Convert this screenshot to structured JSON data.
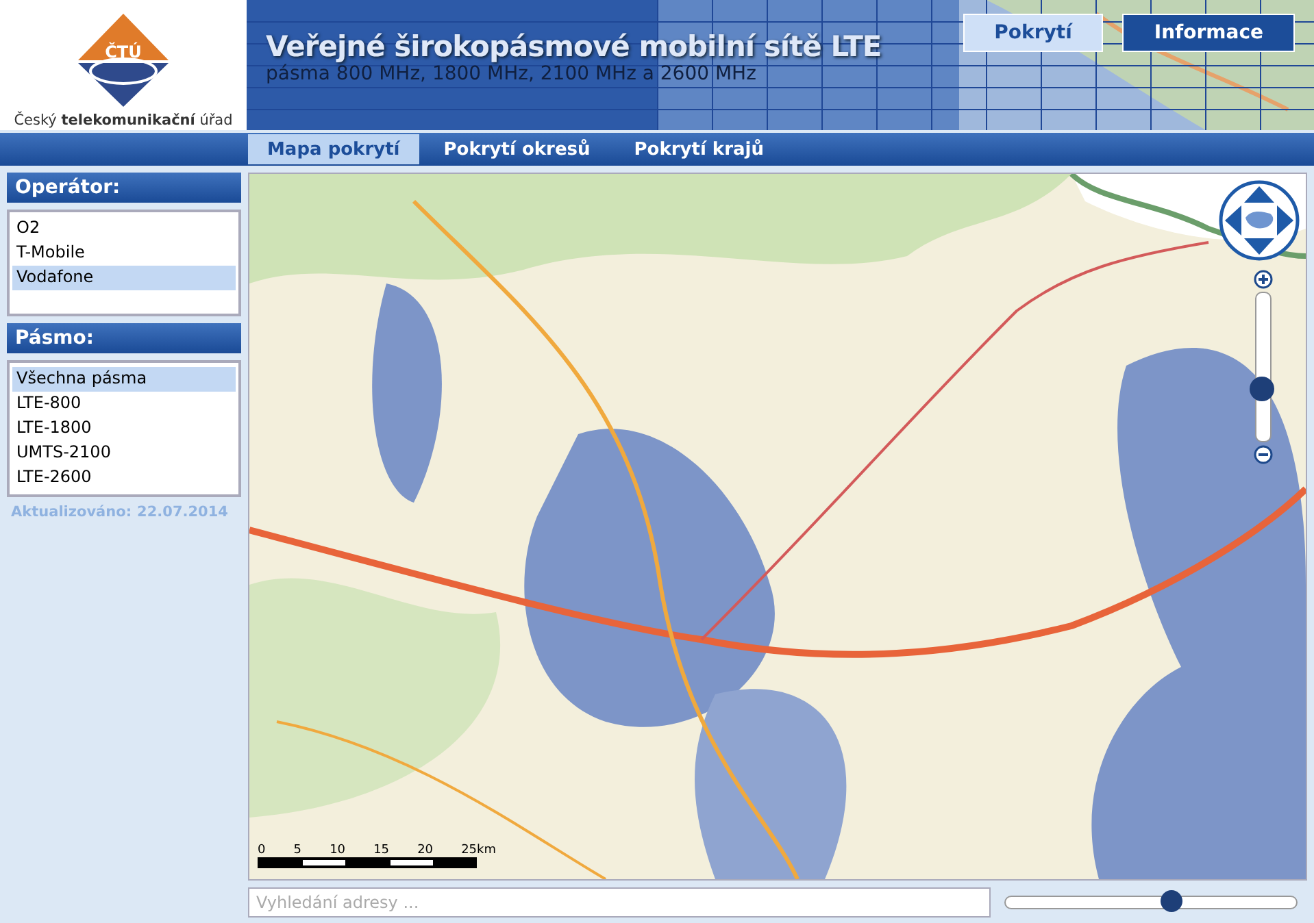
{
  "logo": {
    "mark": "ČTÚ",
    "caption": "Český **telekomunikační** úřad"
  },
  "banner": {
    "title": "Veřejné širokopásmové mobilní sítě LTE",
    "subtitle": "pásma 800 MHz, 1800 MHz, 2100 MHz a 2600 MHz"
  },
  "header_buttons": [
    {
      "label": "Pokrytí",
      "selected": true
    },
    {
      "label": "Informace",
      "selected": false
    }
  ],
  "tabs": [
    {
      "label": "Mapa pokrytí",
      "selected": true
    },
    {
      "label": "Pokrytí okresů",
      "selected": false
    },
    {
      "label": "Pokrytí krajů",
      "selected": false
    }
  ],
  "operator_panel": {
    "title": "Operátor:",
    "items": [
      {
        "label": "O2",
        "selected": false
      },
      {
        "label": "T-Mobile",
        "selected": false
      },
      {
        "label": "Vodafone",
        "selected": true
      }
    ]
  },
  "band_panel": {
    "title": "Pásmo:",
    "items": [
      {
        "label": "Všechna pásma",
        "selected": true
      },
      {
        "label": "LTE-800",
        "selected": false
      },
      {
        "label": "LTE-1800",
        "selected": false
      },
      {
        "label": "UMTS-2100",
        "selected": false
      },
      {
        "label": "LTE-2600",
        "selected": false
      }
    ]
  },
  "updated": {
    "label": "Aktualizováno:",
    "date": "22.07.2014"
  },
  "map": {
    "scale_labels": [
      "0",
      "5",
      "10",
      "15",
      "20",
      "25km"
    ],
    "zoom": {
      "level": 0.35
    }
  },
  "search": {
    "placeholder": "Vyhledání adresy ..."
  },
  "opacity_slider": {
    "level": 0.57
  }
}
